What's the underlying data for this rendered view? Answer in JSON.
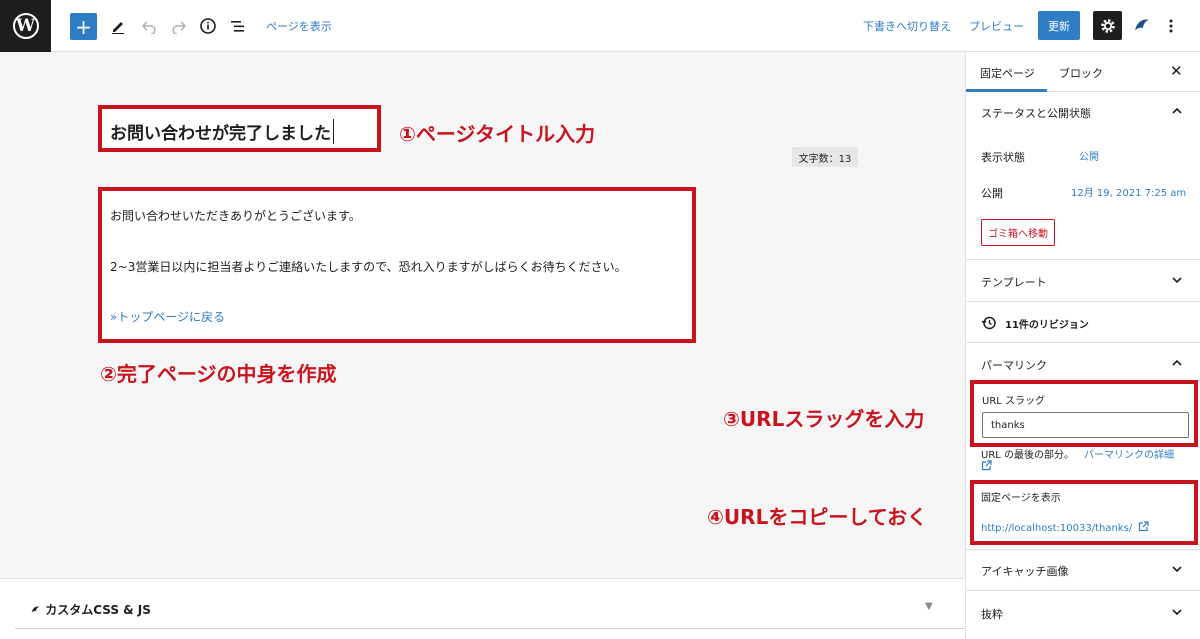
{
  "toolbar": {
    "logo_glyph": "W",
    "add_block_glyph": "+",
    "view_page": "ページを表示",
    "switch_to_draft": "下書きへ切り替え",
    "preview": "プレビュー",
    "update": "更新"
  },
  "editor": {
    "title": "お問い合わせが完了しました",
    "word_count": "文字数：13",
    "paragraphs": [
      "お問い合わせいただきありがとうございます。",
      "2~3営業日以内に担当者よりご連絡いたしますので、恐れ入りますがしばらくお待ちください。",
      "»トップページに戻る"
    ]
  },
  "annotations": {
    "step1": "①ページタイトル入力",
    "step2": "②完了ページの中身を作成",
    "step3": "③URLスラッグを入力",
    "step4": "④URLをコピーしておく"
  },
  "meta_box": {
    "title": "カスタムCSS & JS"
  },
  "sidebar": {
    "tab_page": "固定ページ",
    "tab_block": "ブロック",
    "status_panel": "ステータスと公開状態",
    "visibility_label": "表示状態",
    "visibility_value": "公開",
    "publish_label": "公開",
    "publish_value": "12月 19, 2021 7:25 am",
    "trash": "ゴミ箱へ移動",
    "template_panel": "テンプレート",
    "revisions": "11件のリビジョン",
    "permalink_panel": "パーマリンク",
    "url_slug_label": "URL スラッグ",
    "url_slug_value": "thanks",
    "url_help": "URL の最後の部分。",
    "permalink_details": "パーマリンクの詳細",
    "view_page_label": "固定ページを表示",
    "page_url": "http://localhost:10033/thanks/",
    "featured_image_panel": "アイキャッチ画像",
    "excerpt_panel": "抜粋"
  },
  "colors": {
    "accent": "#2f7dc4",
    "annotation_red": "#c8141f",
    "dark": "#1e1e1e"
  }
}
